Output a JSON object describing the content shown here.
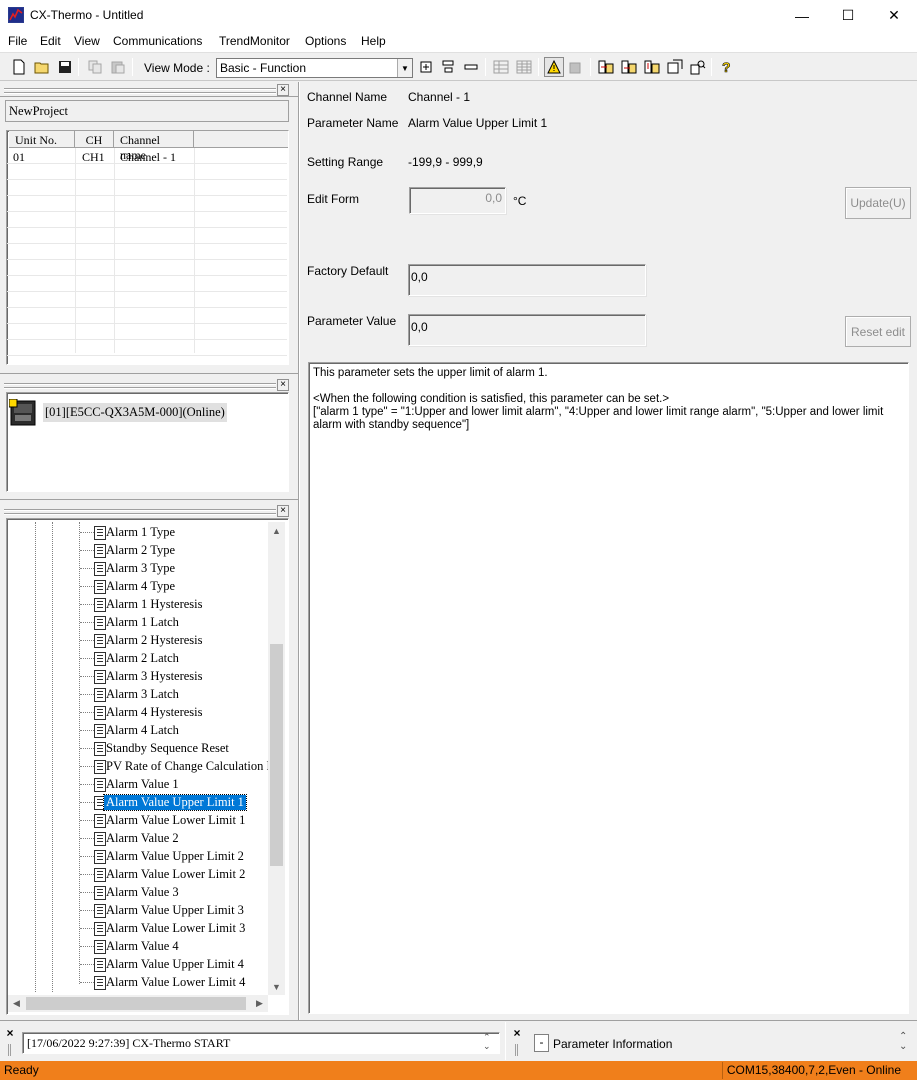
{
  "window": {
    "title": "CX-Thermo - Untitled",
    "controls": {
      "minimize": "—",
      "maximize": "☐",
      "close": "✕"
    }
  },
  "menu": [
    "File",
    "Edit",
    "View",
    "Communications",
    "TrendMonitor",
    "Options",
    "Help"
  ],
  "toolbar": {
    "view_mode_label": "View Mode :",
    "view_mode_value": "Basic - Function"
  },
  "project_pane": {
    "project_name": "NewProject",
    "columns": [
      "Unit No.",
      "CH",
      "Channel name"
    ],
    "rows": [
      {
        "unit": "01",
        "ch": "CH1",
        "name": "Channel - 1"
      }
    ]
  },
  "device_pane": {
    "device_label": "[01][E5CC-QX3A5M-000](Online)"
  },
  "tree": {
    "items": [
      "Alarm 1 Type",
      "Alarm 2 Type",
      "Alarm 3 Type",
      "Alarm 4 Type",
      "Alarm 1 Hysteresis",
      "Alarm 1 Latch",
      "Alarm 2 Hysteresis",
      "Alarm 2 Latch",
      "Alarm 3 Hysteresis",
      "Alarm 3 Latch",
      "Alarm 4 Hysteresis",
      "Alarm 4 Latch",
      "Standby Sequence Reset",
      "PV Rate of Change Calculation Pe",
      "Alarm Value 1",
      "Alarm Value Upper Limit 1",
      "Alarm Value Lower Limit 1",
      "Alarm Value 2",
      "Alarm Value Upper Limit 2",
      "Alarm Value Lower Limit 2",
      "Alarm Value 3",
      "Alarm Value Upper Limit 3",
      "Alarm Value Lower Limit 3",
      "Alarm Value 4",
      "Alarm Value Upper Limit 4",
      "Alarm Value Lower Limit 4"
    ],
    "selected_index": 15
  },
  "detail": {
    "channel_name_label": "Channel Name",
    "channel_name_value": "Channel - 1",
    "parameter_name_label": "Parameter Name",
    "parameter_name_value": "Alarm Value Upper Limit 1",
    "setting_range_label": "Setting Range",
    "setting_range_value": "-199,9 - 999,9",
    "edit_form_label": "Edit Form",
    "edit_form_value": "0,0",
    "edit_form_unit": "°C",
    "update_button": "Update(U)",
    "factory_default_label": "Factory Default",
    "factory_default_value": "0,0",
    "parameter_value_label": "Parameter Value",
    "parameter_value_value": "0,0",
    "reset_edit_button": "Reset edit",
    "description_line1": "This parameter sets the upper limit of alarm 1.",
    "description_line2": "<When the following condition is satisfied, this parameter can be set.>",
    "description_line3": "[\"alarm 1 type\" = \"1:Upper and lower limit alarm\", \"4:Upper and lower limit range alarm\", \"5:Upper and lower limit alarm with standby sequence\"]"
  },
  "log_pane": {
    "entry": "[17/06/2022 9:27:39] CX-Thermo START"
  },
  "info_pane": {
    "expander": "-",
    "label": "Parameter Information"
  },
  "status": {
    "left": "Ready",
    "right": "COM15,38400,7,2,Even - Online"
  },
  "colors": {
    "status_bar": "#f07f1b",
    "selection": "#0078d7"
  }
}
